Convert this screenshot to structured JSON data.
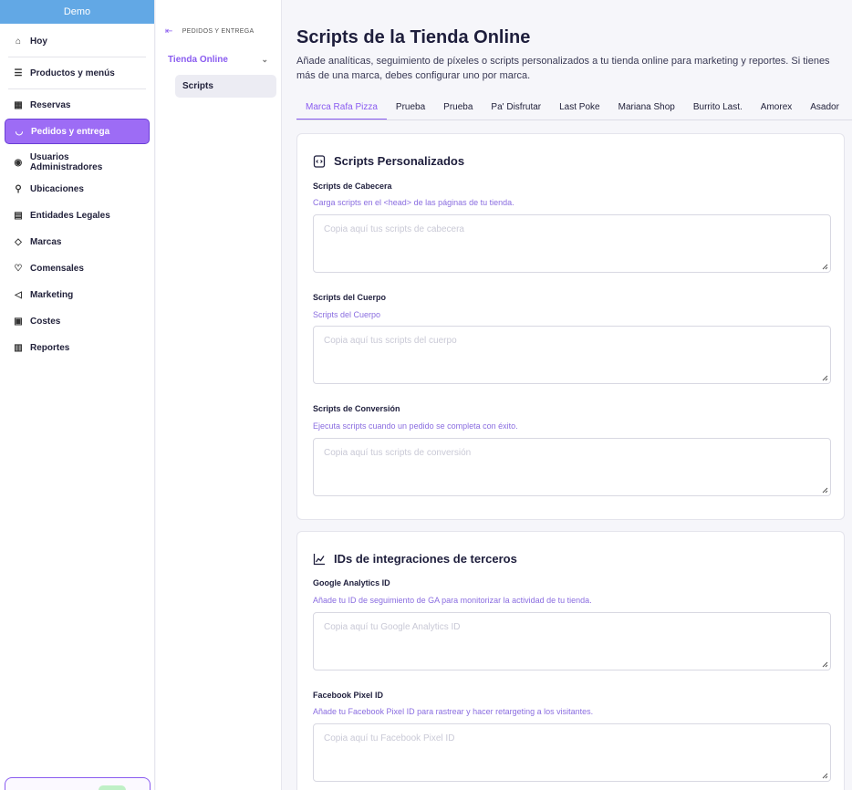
{
  "sidebar": {
    "brand": "Demo",
    "items": [
      {
        "label": "Hoy",
        "icon": "home-icon",
        "glyph": "⌂"
      },
      {
        "label": "Productos y menús",
        "icon": "list-icon",
        "glyph": "☰"
      },
      {
        "label": "Reservas",
        "icon": "calendar-icon",
        "glyph": "▦"
      },
      {
        "label": "Pedidos y entrega",
        "icon": "basket-icon",
        "glyph": "◡"
      },
      {
        "label": "Usuarios Administradores",
        "icon": "user-circle-icon",
        "glyph": "◉"
      },
      {
        "label": "Ubicaciones",
        "icon": "location-icon",
        "glyph": "⚲"
      },
      {
        "label": "Entidades Legales",
        "icon": "building-icon",
        "glyph": "▤"
      },
      {
        "label": "Marcas",
        "icon": "tag-icon",
        "glyph": "◇"
      },
      {
        "label": "Comensales",
        "icon": "heart-icon",
        "glyph": "♡"
      },
      {
        "label": "Marketing",
        "icon": "megaphone-icon",
        "glyph": "◁"
      },
      {
        "label": "Costes",
        "icon": "wallet-icon",
        "glyph": "▣"
      },
      {
        "label": "Reportes",
        "icon": "chart-icon",
        "glyph": "▥"
      }
    ]
  },
  "subnav": {
    "back_label": "PEDIDOS Y ENTREGA",
    "group_label": "Tienda Online",
    "item_label": "Scripts"
  },
  "main": {
    "title": "Scripts de la Tienda Online",
    "description": "Añade analíticas, seguimiento de píxeles o scripts personalizados a tu tienda online para marketing y reportes. Si tienes más de una marca, debes configurar uno por marca.",
    "tabs": [
      "Marca Rafa Pizza",
      "Prueba",
      "Prueba",
      "Pa' Disfrutar",
      "Last Poke",
      "Mariana Shop",
      "Burrito Last.",
      "Amorex",
      "Asador"
    ],
    "active_tab": "Marca Rafa Pizza"
  },
  "scripts_card": {
    "title": "Scripts Personalizados",
    "fields": [
      {
        "label": "Scripts de Cabecera",
        "help": "Carga scripts en el <head> de las páginas de tu tienda.",
        "placeholder": "Copia aquí tus scripts de cabecera"
      },
      {
        "label": "Scripts del Cuerpo",
        "help": "Scripts del Cuerpo",
        "placeholder": "Copia aquí tus scripts del cuerpo"
      },
      {
        "label": "Scripts de Conversión",
        "help": "Ejecuta scripts cuando un pedido se completa con éxito.",
        "placeholder": "Copia aquí tus scripts de conversión"
      }
    ]
  },
  "ids_card": {
    "title": "IDs de integraciones de terceros",
    "fields": [
      {
        "label": "Google Analytics ID",
        "help": "Añade tu ID de seguimiento de GA para monitorizar la actividad de tu tienda.",
        "placeholder": "Copia aquí tu Google Analytics ID"
      },
      {
        "label": "Facebook Pixel ID",
        "help": "Añade tu Facebook Pixel ID para rastrear y hacer retargeting a los visitantes.",
        "placeholder": "Copia aquí tu Facebook Pixel ID"
      }
    ]
  },
  "colors": {
    "accent": "#8a5cf0",
    "active_nav": "#9d6cf5",
    "brand_bar": "#62a8e5"
  }
}
